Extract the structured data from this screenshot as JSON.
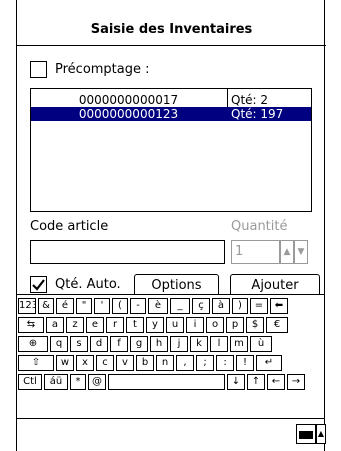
{
  "title": "Saisie des Inventaires",
  "precomptage": {
    "label": "Précomptage :",
    "checked": false
  },
  "list": {
    "rows": [
      {
        "code": "0000000000017",
        "qty": "Qté: 2",
        "selected": false
      },
      {
        "code": "0000000000123",
        "qty": "Qté: 197",
        "selected": true
      }
    ]
  },
  "code_article": {
    "label": "Code article",
    "value": ""
  },
  "quantite": {
    "label": "Quantité",
    "value": "1"
  },
  "qte_auto": {
    "label": "Qté. Auto.",
    "checked": true
  },
  "buttons": {
    "options": "Options",
    "ajouter": "Ajouter"
  },
  "keyboard": {
    "rows": [
      [
        "123",
        "&",
        "é",
        "\"",
        "'",
        "(",
        "-",
        "è",
        "_",
        "ç",
        "à",
        ")",
        "=",
        "⬅"
      ],
      [
        "⇆",
        "a",
        "z",
        "e",
        "r",
        "t",
        "y",
        "u",
        "i",
        "o",
        "p",
        "$",
        "€"
      ],
      [
        "⊕",
        "q",
        "s",
        "d",
        "f",
        "g",
        "h",
        "j",
        "k",
        "l",
        "m",
        "ù"
      ],
      [
        "⇧",
        "w",
        "x",
        "c",
        "v",
        "b",
        "n",
        ",",
        ";",
        ":",
        "!",
        "↵"
      ],
      [
        "Ctl",
        "áü",
        "*",
        "@",
        " ",
        "↓",
        "↑",
        "←",
        "→"
      ]
    ]
  },
  "colors": {
    "selection": "#000080",
    "disabled": "#9a9a9a"
  }
}
